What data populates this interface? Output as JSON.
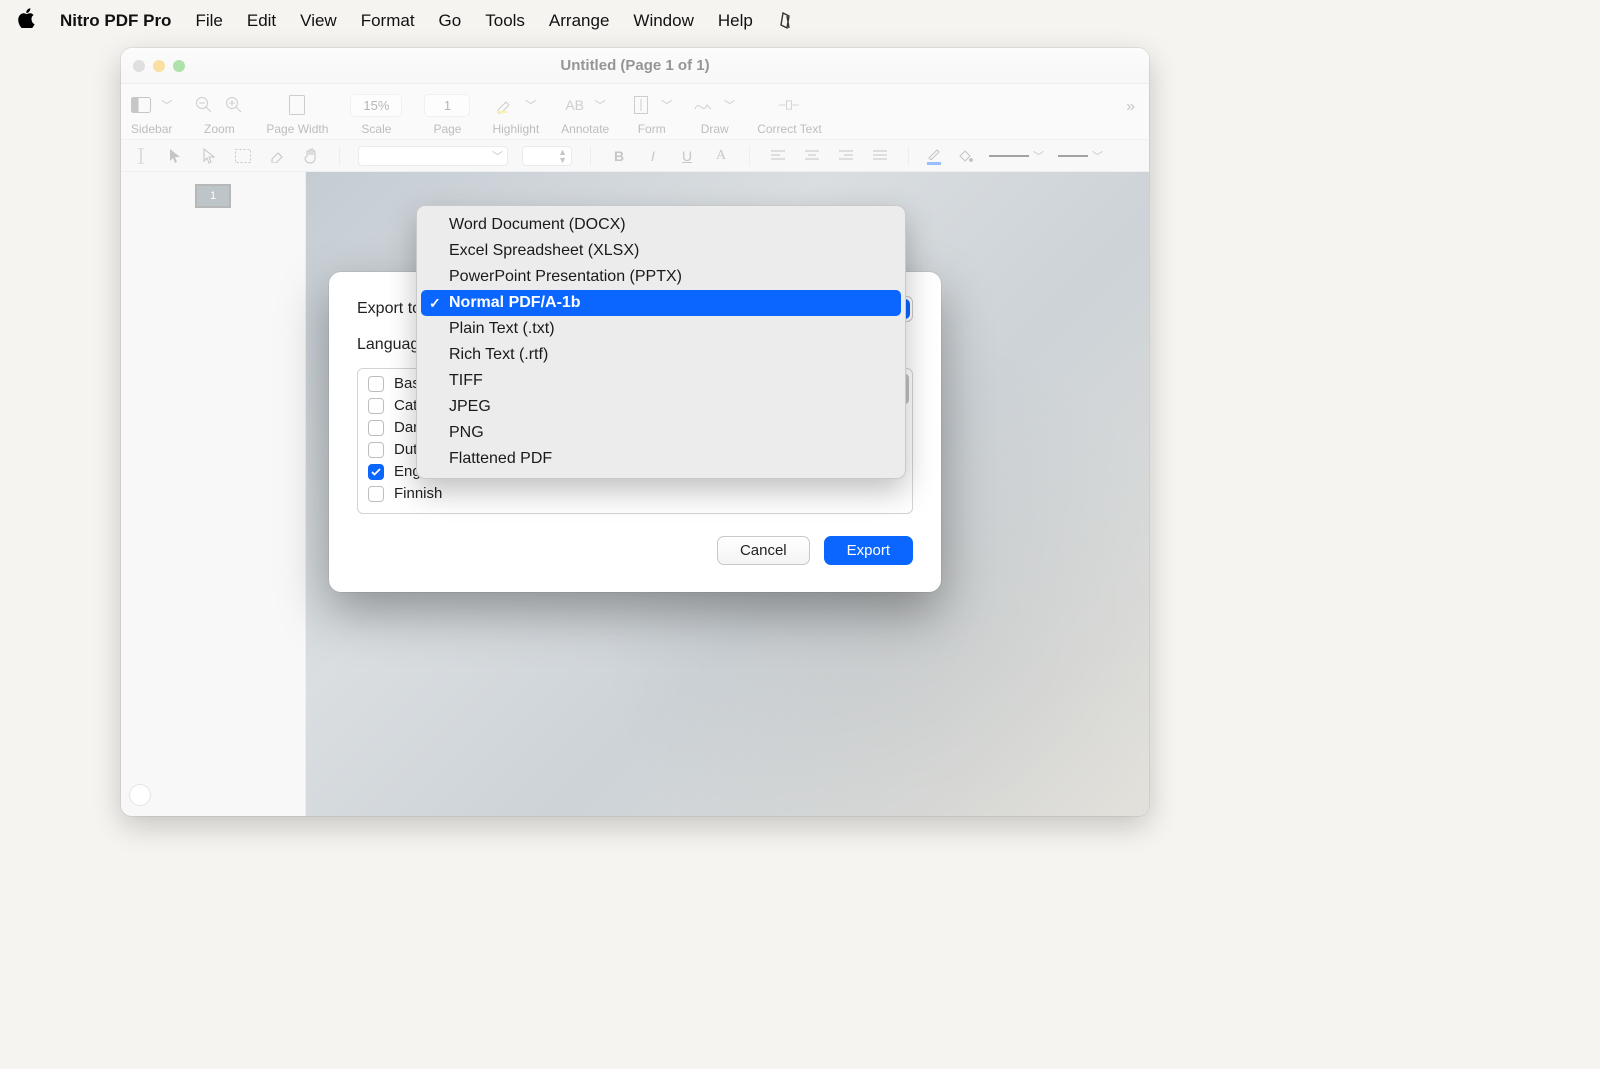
{
  "menubar": {
    "app_name": "Nitro PDF Pro",
    "items": [
      "File",
      "Edit",
      "View",
      "Format",
      "Go",
      "Tools",
      "Arrange",
      "Window",
      "Help"
    ]
  },
  "window": {
    "title": "Untitled (Page 1 of 1)"
  },
  "toolbar": {
    "sidebar_label": "Sidebar",
    "zoom_label": "Zoom",
    "pagewidth_label": "Page Width",
    "scale_label": "Scale",
    "scale_value": "15%",
    "page_label": "Page",
    "page_value": "1",
    "highlight_label": "Highlight",
    "annotate_label": "Annotate",
    "form_label": "Form",
    "draw_label": "Draw",
    "correct_label": "Correct Text"
  },
  "dialog": {
    "export_to_label": "Export to",
    "languages_label": "Languages",
    "cancel": "Cancel",
    "export": "Export",
    "languages": [
      {
        "label": "Basque",
        "checked": false
      },
      {
        "label": "Catalan",
        "checked": false
      },
      {
        "label": "Danish",
        "checked": false
      },
      {
        "label": "Dutch",
        "checked": false
      },
      {
        "label": "English",
        "checked": true
      },
      {
        "label": "Finnish",
        "checked": false
      }
    ]
  },
  "dropdown": {
    "options": [
      "Word Document (DOCX)",
      "Excel Spreadsheet (XLSX)",
      "PowerPoint Presentation (PPTX)",
      "Normal PDF/A-1b",
      "Plain Text (.txt)",
      "Rich Text (.rtf)",
      "TIFF",
      "JPEG",
      "PNG",
      "Flattened PDF"
    ],
    "selected_index": 3
  },
  "thumb": {
    "page_num": "1"
  }
}
